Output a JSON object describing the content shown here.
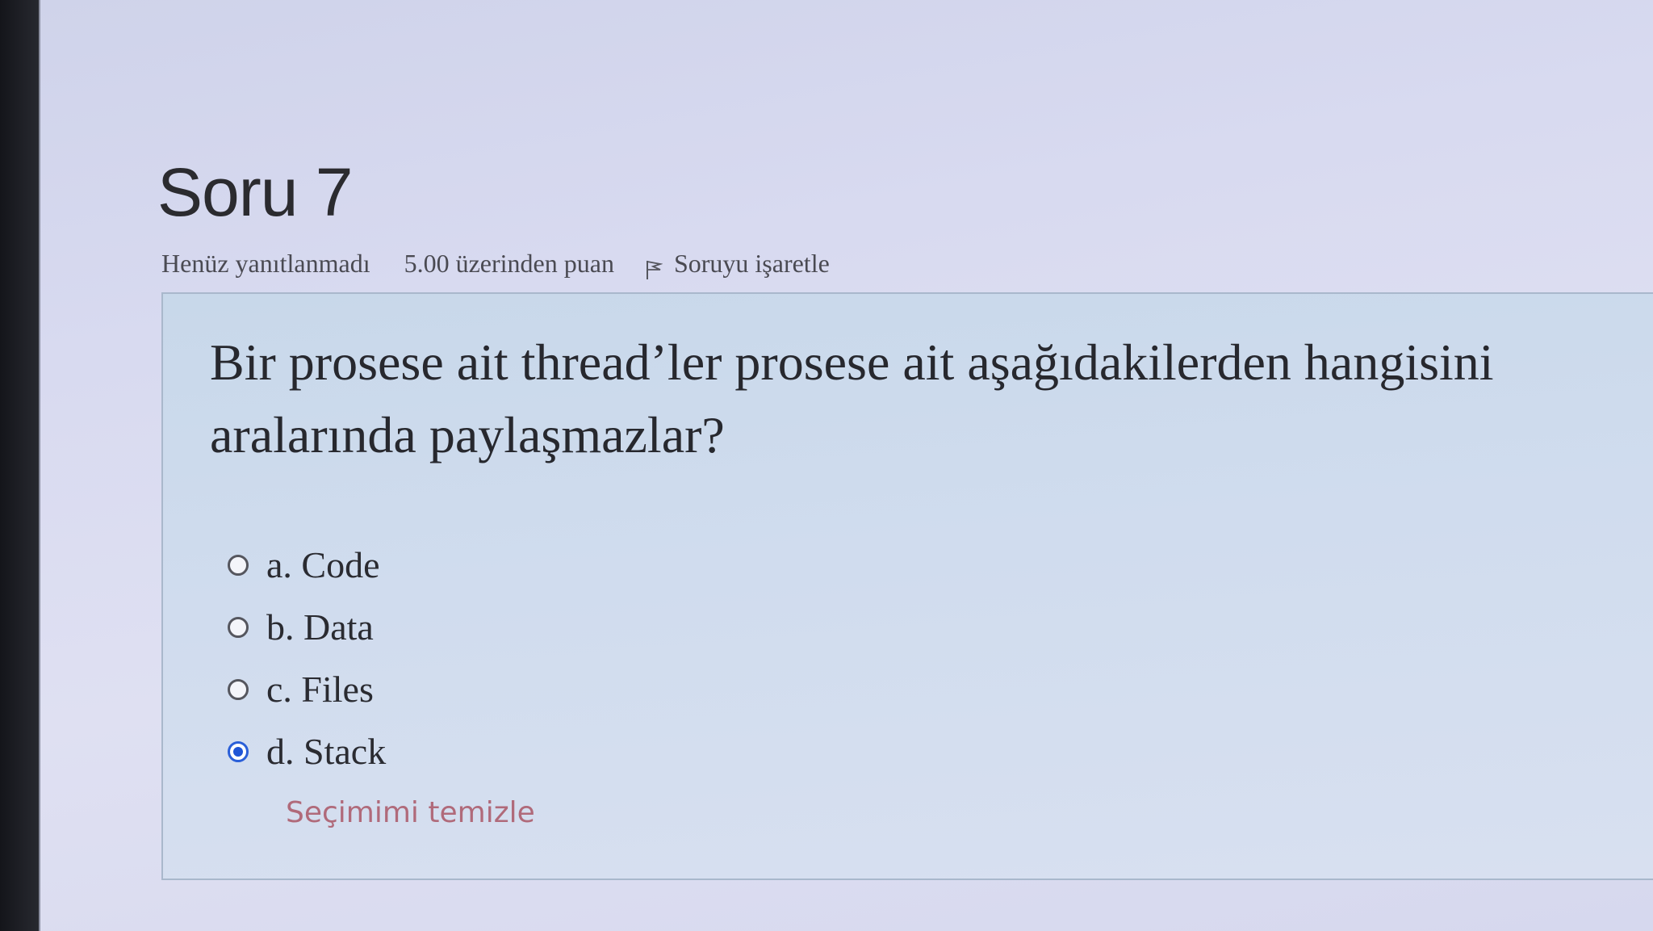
{
  "question": {
    "number_label": "Soru 7",
    "state": "Henüz yanıtlanmadı",
    "grade": "5.00 üzerinden puan",
    "flag_label": "Soruyu işaretle",
    "text": "Bir prosese ait thread’ler prosese ait aşağıdakilerden hangisini aralarında paylaşmazlar?",
    "answers": [
      {
        "label": "a. Code",
        "selected": false
      },
      {
        "label": "b. Data",
        "selected": false
      },
      {
        "label": "c. Files",
        "selected": false
      },
      {
        "label": "d. Stack",
        "selected": true
      }
    ],
    "clear_choice_label": "Seçimimi temizle"
  },
  "colors": {
    "selected_radio": "#1f55d6",
    "clear_link": "#b06a7a"
  },
  "icons": {
    "flag": "flag-icon"
  }
}
